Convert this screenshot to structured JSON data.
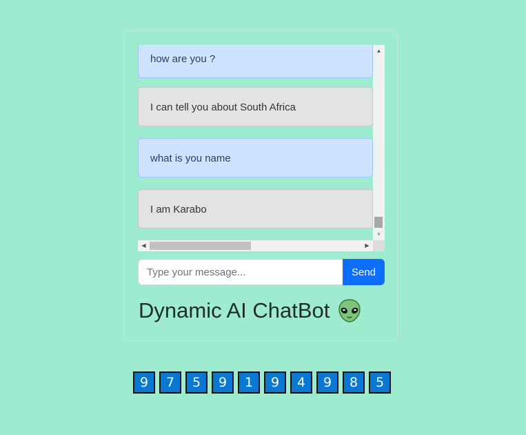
{
  "chat": {
    "messages": [
      {
        "role": "user",
        "text": "how are you ?"
      },
      {
        "role": "bot",
        "text": "I can tell you about South Africa"
      },
      {
        "role": "user",
        "text": "what is you name"
      },
      {
        "role": "bot",
        "text": "I am Karabo"
      }
    ]
  },
  "composer": {
    "placeholder": "Type your message...",
    "send_label": "Send"
  },
  "title": "Dynamic AI ChatBot",
  "title_icon": "alien-face-icon",
  "digits": [
    "9",
    "7",
    "5",
    "9",
    "1",
    "9",
    "4",
    "9",
    "8",
    "5"
  ],
  "colors": {
    "background": "#9eebd0",
    "user_bubble": "#cfe2ff",
    "bot_bubble": "#e2e3e5",
    "send_button": "#0d6efd",
    "digit_box": "#0a78d1"
  }
}
